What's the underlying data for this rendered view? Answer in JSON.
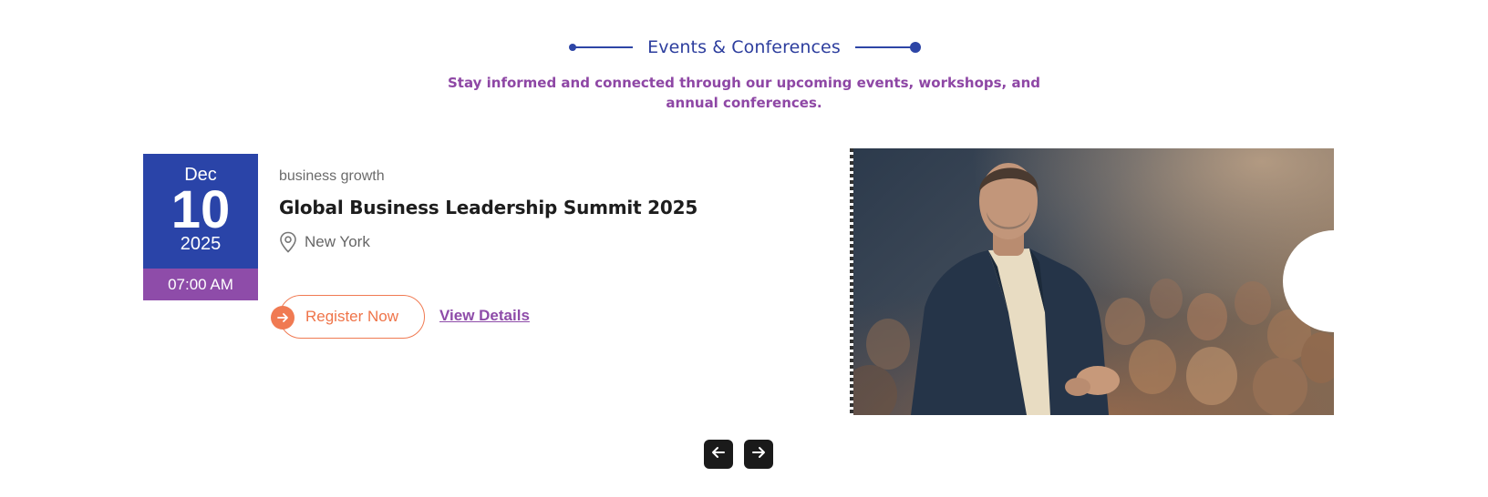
{
  "section": {
    "title": "Events & Conferences",
    "subtitle": "Stay informed and connected through our upcoming events, workshops, and annual conferences."
  },
  "event": {
    "date": {
      "month": "Dec",
      "day": "10",
      "year": "2025",
      "time": "07:00 AM"
    },
    "category": "business growth",
    "title": "Global Business Leadership Summit 2025",
    "location": "New York",
    "register_label": "Register Now",
    "details_label": "View Details",
    "image_alt": "Speaker in suit addressing a conference audience"
  },
  "pager": {
    "prev_icon": "arrow-left-icon",
    "next_icon": "arrow-right-icon"
  },
  "colors": {
    "primary": "#2a44a8",
    "accent_purple": "#8e4ca9",
    "accent_orange": "#f07a52"
  }
}
